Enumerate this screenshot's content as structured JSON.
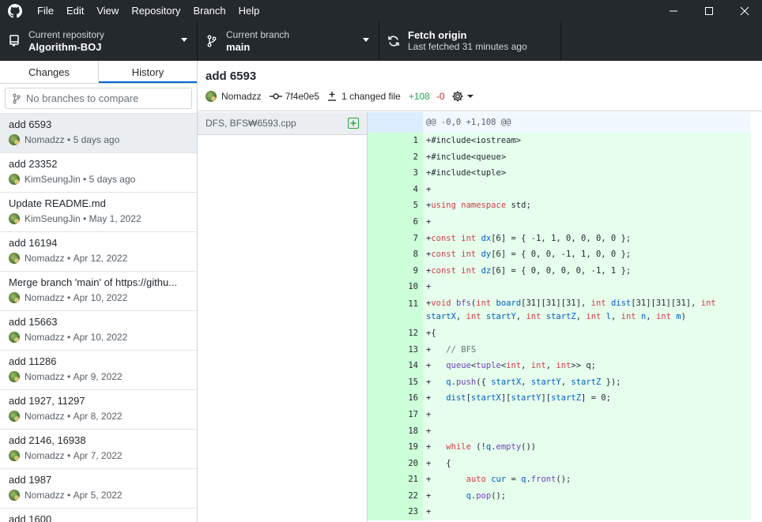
{
  "menu": [
    "File",
    "Edit",
    "View",
    "Repository",
    "Branch",
    "Help"
  ],
  "toolbar": {
    "repo_label": "Current repository",
    "repo_value": "Algorithm-BOJ",
    "branch_label": "Current branch",
    "branch_value": "main",
    "fetch_label": "Fetch origin",
    "fetch_sub": "Last fetched 31 minutes ago"
  },
  "sidebar": {
    "tabs": [
      "Changes",
      "History"
    ],
    "compare_placeholder": "No branches to compare",
    "commits": [
      {
        "title": "add 6593",
        "author": "Nomadzz",
        "date": "5 days ago"
      },
      {
        "title": "add 23352",
        "author": "KimSeungJin",
        "date": "5 days ago"
      },
      {
        "title": "Update README.md",
        "author": "KimSeungJin",
        "date": "May 1, 2022"
      },
      {
        "title": "add 16194",
        "author": "Nomadzz",
        "date": "Apr 12, 2022"
      },
      {
        "title": "Merge branch 'main' of https://githu...",
        "author": "Nomadzz",
        "date": "Apr 10, 2022"
      },
      {
        "title": "add 15663",
        "author": "Nomadzz",
        "date": "Apr 10, 2022"
      },
      {
        "title": "add 11286",
        "author": "Nomadzz",
        "date": "Apr 9, 2022"
      },
      {
        "title": "add 1927, 11297",
        "author": "Nomadzz",
        "date": "Apr 8, 2022"
      },
      {
        "title": "add 2146, 16938",
        "author": "Nomadzz",
        "date": "Apr 7, 2022"
      },
      {
        "title": "add 1987",
        "author": "Nomadzz",
        "date": "Apr 5, 2022"
      },
      {
        "title": "add 1600",
        "author": "",
        "date": ""
      }
    ]
  },
  "commit": {
    "title": "add 6593",
    "author": "Nomadzz",
    "sha": "7f4e0e5",
    "changed": "1 changed file",
    "additions": "+108",
    "deletions": "-0"
  },
  "files": [
    {
      "path": "DFS, BFS₩6593.cpp"
    }
  ],
  "diff": {
    "hunk": "@@ -0,0 +1,108 @@",
    "lines": [
      {
        "n": "1",
        "html": "+#include&lt;iostream&gt;"
      },
      {
        "n": "2",
        "html": "+#include&lt;queue&gt;"
      },
      {
        "n": "3",
        "html": "+#include&lt;tuple&gt;"
      },
      {
        "n": "4",
        "html": "+"
      },
      {
        "n": "5",
        "html": "+<span class=\"kw\">using namespace</span> std;"
      },
      {
        "n": "6",
        "html": "+"
      },
      {
        "n": "7",
        "html": "+<span class=\"kw\">const int</span> <span class=\"var\">dx</span>[6] = { -1, 1, 0, 0, 0, 0 };"
      },
      {
        "n": "8",
        "html": "+<span class=\"kw\">const int</span> <span class=\"var\">dy</span>[6] = { 0, 0, -1, 1, 0, 0 };"
      },
      {
        "n": "9",
        "html": "+<span class=\"kw\">const int</span> <span class=\"var\">dz</span>[6] = { 0, 0, 0, 0, -1, 1 };"
      },
      {
        "n": "10",
        "html": "+"
      },
      {
        "n": "11",
        "html": "+<span class=\"kw\">void</span> <span class=\"fn\">bfs</span>(<span class=\"kw\">int</span> <span class=\"var\">board</span>[31][31][31], <span class=\"kw\">int</span> <span class=\"var\">dist</span>[31][31][31], <span class=\"kw\">int</span> <span class=\"var\">startX</span>, <span class=\"kw\">int</span> <span class=\"var\">startY</span>, <span class=\"kw\">int</span> <span class=\"var\">startZ</span>, <span class=\"kw\">int</span> <span class=\"var\">l</span>, <span class=\"kw\">int</span> <span class=\"var\">n</span>, <span class=\"kw\">int</span> <span class=\"var\">m</span>)"
      },
      {
        "n": "12",
        "html": "+{"
      },
      {
        "n": "13",
        "html": "+   <span class=\"cm\">// BFS</span>"
      },
      {
        "n": "14",
        "html": "+   <span class=\"fn\">queue</span>&lt;<span class=\"fn\">tuple</span>&lt;<span class=\"kw\">int</span>, <span class=\"kw\">int</span>, <span class=\"kw\">int</span>&gt;&gt; q;"
      },
      {
        "n": "15",
        "html": "+   <span class=\"var\">q</span>.<span class=\"fn\">push</span>({ <span class=\"var\">startX</span>, <span class=\"var\">startY</span>, <span class=\"var\">startZ</span> });"
      },
      {
        "n": "16",
        "html": "+   <span class=\"var\">dist</span>[<span class=\"var\">startX</span>][<span class=\"var\">startY</span>][<span class=\"var\">startZ</span>] = 0;"
      },
      {
        "n": "17",
        "html": "+"
      },
      {
        "n": "18",
        "html": "+"
      },
      {
        "n": "19",
        "html": "+   <span class=\"kw\">while</span> (!<span class=\"var\">q</span>.<span class=\"fn\">empty</span>())"
      },
      {
        "n": "20",
        "html": "+   {"
      },
      {
        "n": "21",
        "html": "+       <span class=\"kw\">auto</span> <span class=\"var\">cur</span> = <span class=\"var\">q</span>.<span class=\"fn\">front</span>();"
      },
      {
        "n": "22",
        "html": "+       <span class=\"var\">q</span>.<span class=\"fn\">pop</span>();"
      },
      {
        "n": "23",
        "html": "+"
      }
    ]
  }
}
